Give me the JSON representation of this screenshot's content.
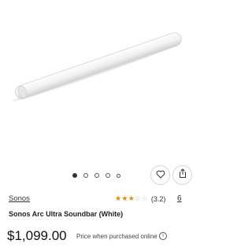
{
  "product": {
    "brand": "Sonos",
    "title": "Sonos Arc Ultra Soundbar (White)",
    "rating": 3.2,
    "rating_text": "(3.2)",
    "review_count": "6",
    "price": "$1,099.00",
    "price_note": "Price when purchased online",
    "image": "soundbar-white"
  },
  "carousel": {
    "total": 5,
    "active_index": 0
  },
  "icons": {
    "favorite": "heart-icon",
    "share": "share-icon",
    "info": "info-icon"
  },
  "colors": {
    "star": "#d88f00",
    "background": "#ffffff"
  }
}
